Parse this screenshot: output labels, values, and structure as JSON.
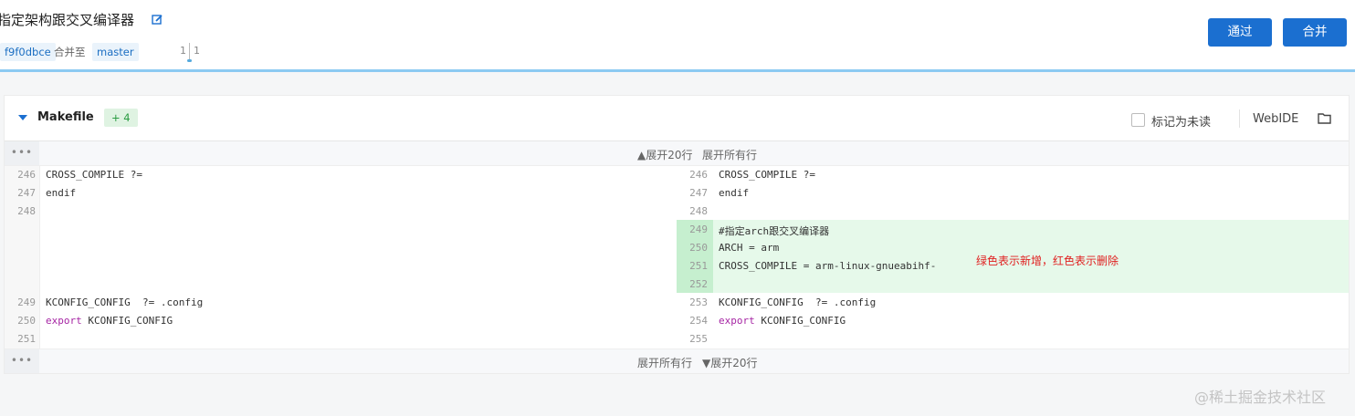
{
  "header": {
    "title": "指定架构跟交叉编译器",
    "commit": "f9f0dbce",
    "merge_to_label": "合并至",
    "branch": "master",
    "counter_left": "1",
    "counter_right": "1",
    "approve_label": "通过",
    "merge_label": "合并"
  },
  "file": {
    "name": "Makefile",
    "badge": "+ 4",
    "mark_unread_label": "标记为未读",
    "webide_label": "WebIDE"
  },
  "expand": {
    "top_20": "▲展开20行",
    "top_all": "展开所有行",
    "bottom_all": "展开所有行",
    "bottom_20": "▼展开20行",
    "dots": "•••"
  },
  "diff": {
    "left": [
      {
        "ln": "246",
        "code": "CROSS_COMPILE ?="
      },
      {
        "ln": "247",
        "code": "endif"
      },
      {
        "ln": "248",
        "code": ""
      },
      {
        "ln": "249",
        "code": "KCONFIG_CONFIG  ?= .config"
      },
      {
        "ln": "250",
        "kw": "export",
        "code": " KCONFIG_CONFIG"
      },
      {
        "ln": "251",
        "code": ""
      }
    ],
    "right": [
      {
        "ln": "246",
        "code": "CROSS_COMPILE ?="
      },
      {
        "ln": "247",
        "code": "endif"
      },
      {
        "ln": "248",
        "code": ""
      },
      {
        "ln": "249",
        "code": "#指定arch跟交叉编译器"
      },
      {
        "ln": "250",
        "code": "ARCH = arm"
      },
      {
        "ln": "251",
        "code": "CROSS_COMPILE = arm-linux-gnueabihf-"
      },
      {
        "ln": "252",
        "code": ""
      },
      {
        "ln": "253",
        "code": "KCONFIG_CONFIG  ?= .config"
      },
      {
        "ln": "254",
        "kw": "export",
        "code": " KCONFIG_CONFIG"
      },
      {
        "ln": "255",
        "code": ""
      }
    ]
  },
  "annotation": "绿色表示新增，红色表示删除",
  "watermark": "@稀土掘金技术社区",
  "colors": {
    "accent": "#1b6fd0",
    "added_bg": "#e6f9ea",
    "added_gutter": "#c6efcf",
    "annotation": "#e02020"
  }
}
